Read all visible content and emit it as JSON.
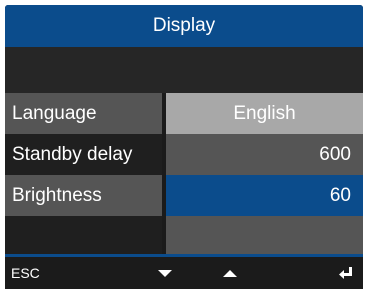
{
  "title": "Display",
  "settings": [
    {
      "label": "Language",
      "value": "English"
    },
    {
      "label": "Standby delay",
      "value": "600"
    },
    {
      "label": "Brightness",
      "value": "60"
    },
    {
      "label": "",
      "value": ""
    }
  ],
  "softkeys": {
    "esc": "ESC",
    "down_icon": "down-arrow-icon",
    "up_icon": "up-arrow-icon",
    "enter_icon": "enter-icon"
  },
  "colors": {
    "accent": "#0b4c8c",
    "background": "#1b1b1b",
    "label_gray": "#555555",
    "value_light": "#a8a8a8"
  }
}
